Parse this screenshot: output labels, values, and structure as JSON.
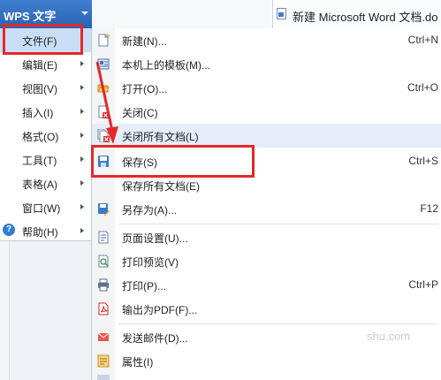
{
  "titlebar": {
    "app_button_label": "WPS 文字",
    "document_tab_title": "新建 Microsoft Word 文档.do"
  },
  "left_menu": {
    "items": [
      {
        "label": "文件(F)"
      },
      {
        "label": "编辑(E)"
      },
      {
        "label": "视图(V)"
      },
      {
        "label": "插入(I)"
      },
      {
        "label": "格式(O)"
      },
      {
        "label": "工具(T)"
      },
      {
        "label": "表格(A)"
      },
      {
        "label": "窗口(W)"
      },
      {
        "label": "帮助(H)"
      }
    ]
  },
  "file_menu": {
    "items": [
      {
        "label": "新建(N)...",
        "shortcut": "Ctrl+N",
        "icon": "new-document-icon"
      },
      {
        "label": "本机上的模板(M)...",
        "shortcut": "",
        "icon": "template-icon"
      },
      {
        "label": "打开(O)...",
        "shortcut": "Ctrl+O",
        "icon": "open-folder-icon"
      },
      {
        "label": "关闭(C)",
        "shortcut": "",
        "icon": "close-document-icon"
      },
      {
        "label": "关闭所有文档(L)",
        "shortcut": "",
        "icon": "close-all-documents-icon"
      },
      {
        "label": "保存(S)",
        "shortcut": "Ctrl+S",
        "icon": "save-icon"
      },
      {
        "label": "保存所有文档(E)",
        "shortcut": "",
        "icon": ""
      },
      {
        "label": "另存为(A)...",
        "shortcut": "F12",
        "icon": "save-as-icon"
      },
      {
        "label": "页面设置(U)...",
        "shortcut": "",
        "icon": "page-setup-icon"
      },
      {
        "label": "打印预览(V)",
        "shortcut": "",
        "icon": "print-preview-icon"
      },
      {
        "label": "打印(P)...",
        "shortcut": "Ctrl+P",
        "icon": "printer-icon"
      },
      {
        "label": "输出为PDF(F)...",
        "shortcut": "",
        "icon": "pdf-icon"
      },
      {
        "label": "发送邮件(D)...",
        "shortcut": "",
        "icon": "mail-icon"
      },
      {
        "label": "属性(I)",
        "shortcut": "",
        "icon": "properties-icon"
      }
    ]
  },
  "watermark_text": "shu.com",
  "colors": {
    "title_button_bg": "#2f6cbd",
    "menu_selected_bg": "#c9def4",
    "menu_hover_bg": "#e4edf8",
    "annotation_red": "#e5282a"
  }
}
